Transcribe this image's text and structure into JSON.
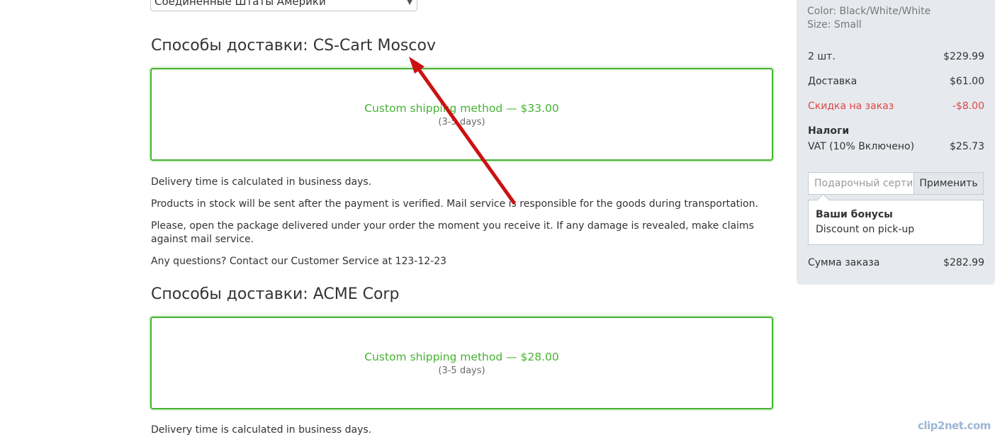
{
  "address": {
    "country_value": "Соединенные Штаты Америки"
  },
  "shipping_sections": [
    {
      "title": "Способы доставки: CS-Cart Moscov",
      "method": "Custom shipping method — $33.00",
      "time": "(3-5 days)",
      "info": [
        "Delivery time is calculated in business days.",
        "Products in stock will be sent after the payment is verified. Mail service is responsible for the goods during transportation.",
        "Please, open the package delivered under your order the moment you receive it. If any damage is revealed, make claims against mail service.",
        "Any questions? Contact our Customer Service at 123-12-23"
      ]
    },
    {
      "title": "Способы доставки: ACME Corp",
      "method": "Custom shipping method — $28.00",
      "time": "(3-5 days)",
      "info": [
        "Delivery time is calculated in business days."
      ]
    }
  ],
  "summary": {
    "product_options": [
      "Color: Black/White/White",
      "Size: Small"
    ],
    "rows": {
      "items": {
        "label": "2 шт.",
        "value": "$229.99"
      },
      "shipping": {
        "label": "Доставка",
        "value": "$61.00"
      },
      "discount": {
        "label": "Скидка на заказ",
        "value": "-$8.00"
      }
    },
    "taxes_title": "Налоги",
    "tax_row": {
      "label": "VAT (10% Включено)",
      "value": "$25.73"
    },
    "gift_placeholder": "Подарочный сертификат",
    "apply_label": "Применить",
    "bonus_title": "Ваши бонусы",
    "bonus_item": "Discount on pick-up",
    "total": {
      "label": "Сумма заказа",
      "value": "$282.99"
    }
  },
  "colors": {
    "accent_green": "#46b232",
    "discount_red": "#e04646",
    "sidebar_bg": "#e6eaee",
    "annotation_arrow": "#cc1111"
  },
  "watermark": "clip2net.com"
}
